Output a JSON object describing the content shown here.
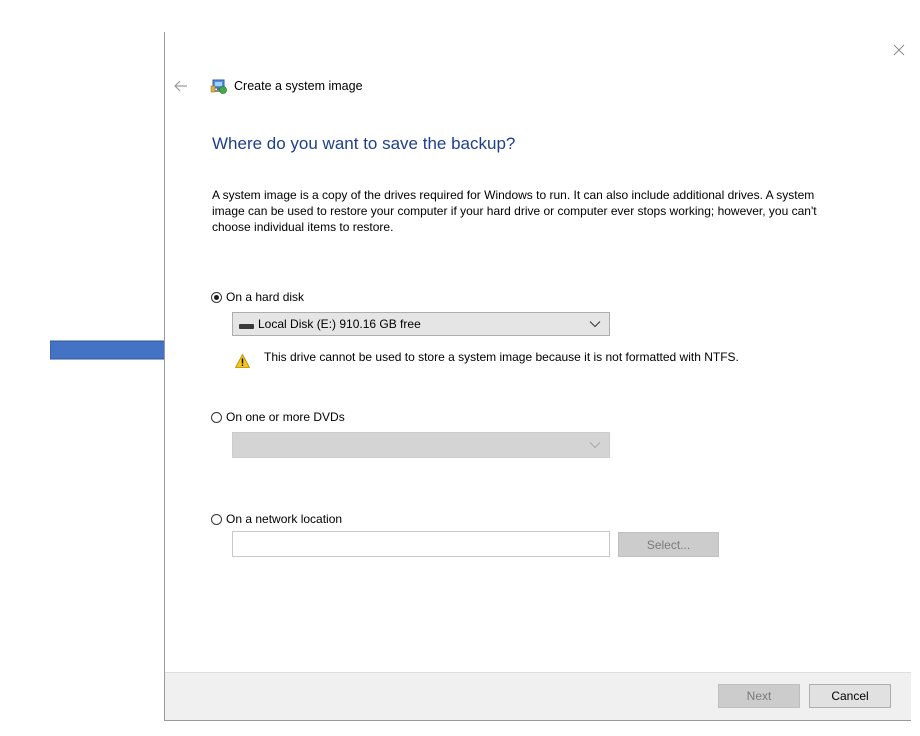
{
  "wizard": {
    "title": "Create a system image",
    "heading": "Where do you want to save the backup?",
    "description": "A system image is a copy of the drives required for Windows to run. It can also include additional drives. A system image can be used to restore your computer if your hard drive or computer ever stops working; however, you can't choose individual items to restore."
  },
  "options": {
    "hard_disk": {
      "label": "On a hard disk",
      "selected": true,
      "drive_value": "Local Disk (E:)  910.16 GB free",
      "warning": "This drive cannot be used to store a system image because it is not formatted with NTFS."
    },
    "dvd": {
      "label": "On one or more DVDs",
      "selected": false,
      "drive_value": ""
    },
    "network": {
      "label": "On a network location",
      "selected": false,
      "path_value": "",
      "select_label": "Select..."
    }
  },
  "footer": {
    "next_label": "Next",
    "cancel_label": "Cancel"
  },
  "colors": {
    "heading": "#1e3f8c",
    "annotation_arrow": "#4472c4",
    "footer_bg": "#f0f0f0"
  },
  "icons": {
    "close": "close-icon",
    "back": "back-arrow-icon",
    "wizard": "system-image-icon",
    "drive": "hard-drive-icon",
    "warning": "warning-icon",
    "chevron": "chevron-down-icon",
    "annotation": "annotation-arrow-icon"
  }
}
